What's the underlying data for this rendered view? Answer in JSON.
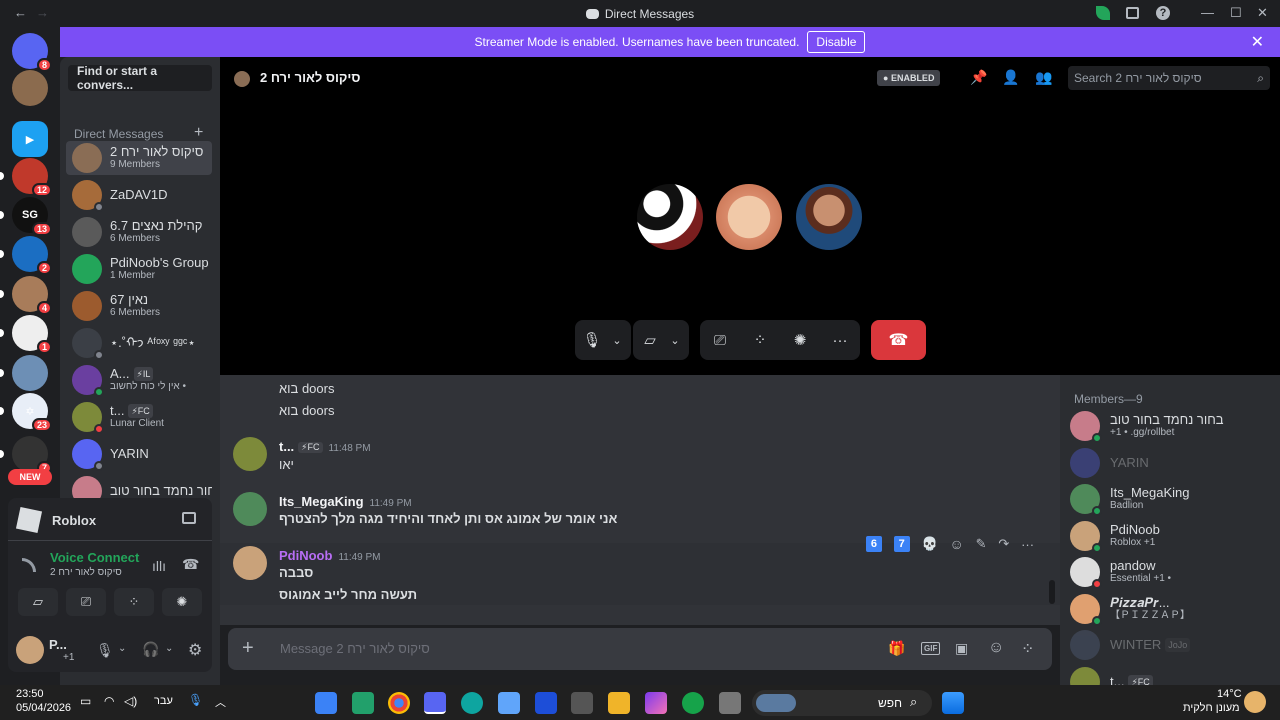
{
  "titlebar": {
    "title": "Direct Messages",
    "back": "←",
    "fwd": "→",
    "min": "—",
    "max": "☐",
    "close": "✕"
  },
  "banner": {
    "text": "Streamer Mode is enabled. Usernames have been truncated.",
    "disable": "Disable",
    "close": "✕"
  },
  "guilds": [
    {
      "label": "",
      "badge": "8",
      "color": "#5865f2"
    },
    {
      "label": "",
      "badge": "",
      "color": "#8b6b4e"
    },
    {
      "label": "▶",
      "badge": "",
      "color": "#1da1f2"
    },
    {
      "label": "",
      "badge": "12",
      "color": "#c0392b"
    },
    {
      "label": "SG",
      "badge": "13",
      "color": "#111"
    },
    {
      "label": "",
      "badge": "2",
      "color": "#1b6ec2"
    },
    {
      "label": "",
      "badge": "4",
      "color": "#a87c5a"
    },
    {
      "label": "",
      "badge": "1",
      "color": "#eee"
    },
    {
      "label": "",
      "badge": "",
      "color": "#6d8fb5"
    },
    {
      "label": "✡",
      "badge": "23",
      "color": "#e8eef7"
    },
    {
      "label": "",
      "badge": "7",
      "color": "#333"
    }
  ],
  "guild_new": "NEW",
  "sidebar": {
    "search": "Find or start a convers...",
    "dm_header": "Direct Messages",
    "plus": "+",
    "dms": [
      {
        "name": "סיקוס לאור ירח 2",
        "sub": "9 Members",
        "color": "#8a6d55",
        "status": ""
      },
      {
        "name": "ZaDAV1D",
        "sub": "",
        "color": "#a66b3a",
        "status": "#80848e"
      },
      {
        "name": "6.7 קהילת נאצים",
        "sub": "6 Members",
        "color": "#5a5a5a",
        "status": ""
      },
      {
        "name": "PdiNoob's Group",
        "sub": "1 Member",
        "color": "#23a55a",
        "status": ""
      },
      {
        "name": "67 נאין",
        "sub": "6 Members",
        "color": "#9c5b2e",
        "status": ""
      },
      {
        "name": "⋆.˚ᡣ𐭩 ᴬᶠᵒˣʸ ᵍᵍᶜ⋆",
        "sub": "",
        "color": "#3b3f46",
        "status": "#80848e"
      },
      {
        "name": "A...",
        "sub": "אין לי כוח לחשוב •",
        "tag": "⚡IL",
        "color": "#6a3fa0",
        "status": "#23a55a"
      },
      {
        "name": "t...",
        "sub": "Lunar Client",
        "tag": "⚡FC",
        "color": "#7d8a3a",
        "status": "#f23f43"
      },
      {
        "name": "YARIN",
        "sub": "",
        "color": "#5865f2",
        "status": "#80848e"
      },
      {
        "name": "בחור נחמד בחור טוב...",
        "sub": "",
        "color": "#c77c8a",
        "status": ""
      }
    ]
  },
  "panel": {
    "game": "Roblox",
    "voice": "Voice Connecte",
    "voice_sub": "סיקוס לאור ירח 2",
    "user": "P...",
    "user_sub": "+1"
  },
  "call": {
    "channel": "סיקוס לאור ירח 2",
    "enabled": "ENABLED",
    "search": "Search סיקוס לאור ירח 2"
  },
  "messages": [
    {
      "text": "בוא doors"
    },
    {
      "text": "בוא doors"
    },
    {
      "user": "t...",
      "tag": "⚡FC",
      "time": "11:48 PM",
      "text": "יאו",
      "color": "#7d8a3a"
    },
    {
      "user": "Its_MegaKing",
      "time": "11:49 PM",
      "text": "אני אומר של אמונג אס ותן לאחד והיחיד מגה מלך להצטרף",
      "color": "#4f8a5a"
    },
    {
      "user": "PdiNoob",
      "time": "11:49 PM",
      "text": "סבבה",
      "color": "#c9a27a"
    },
    {
      "text": "תעשה מחר לייב אמוגוס"
    }
  ],
  "hoverbar": {
    "k1": "6",
    "k2": "7"
  },
  "composer": {
    "placeholder": "Message סיקוס לאור ירח 2",
    "gif": "GIF"
  },
  "members": {
    "header": "Members—9",
    "list": [
      {
        "name": "בחור נחמד בחור טוב",
        "sub": "+1 • .gg/rollbet",
        "color": "#c77c8a",
        "status": "#23a55a"
      },
      {
        "name": "YARIN",
        "sub": "",
        "color": "#5865f2",
        "status": "",
        "dim": true
      },
      {
        "name": "Its_MegaKing",
        "sub": "Badlion",
        "color": "#4f8a5a",
        "status": "#23a55a"
      },
      {
        "name": "PdiNoob",
        "sub": "Roblox +1",
        "color": "#c9a27a",
        "status": "#23a55a"
      },
      {
        "name": "pandow",
        "sub": "Essential +1 •",
        "color": "#ddd",
        "status": "#f23f43"
      },
      {
        "name": "𝑷𝒊𝒛𝒛𝒂𝑷𝒓...",
        "sub": "【ＰＩＺＺＡＰ】",
        "color": "#e0a070",
        "status": "#23a55a"
      },
      {
        "name": "WINTER",
        "sub": "",
        "tag": "JoJo",
        "color": "#5b6b8a",
        "status": "",
        "dim": true
      },
      {
        "name": "t...",
        "sub": "",
        "tag": "⚡FC",
        "color": "#7d8a3a",
        "status": ""
      }
    ]
  },
  "taskbar": {
    "time": "23:50",
    "date": "05/04/2026",
    "lang": "עבר",
    "search": "חפש",
    "temp": "14°C",
    "weather": "מעונן חלקית"
  }
}
